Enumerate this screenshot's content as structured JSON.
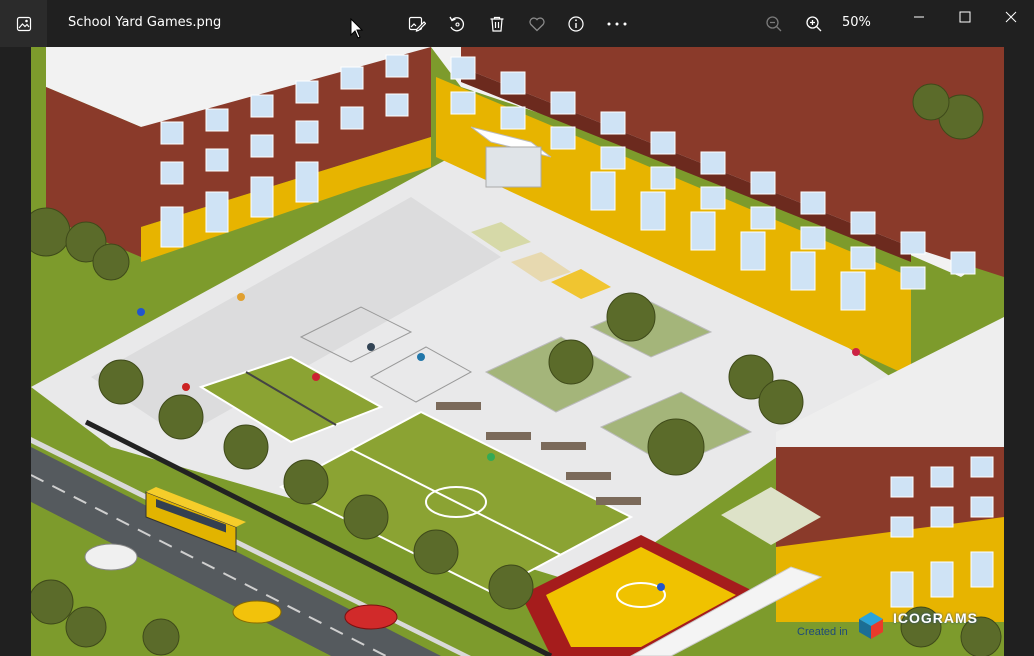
{
  "window": {
    "filename": "School Yard Games.png",
    "zoom_label": "50%"
  },
  "toolbar": {
    "icons": [
      "edit-image-icon",
      "rotate-icon",
      "delete-icon",
      "favorite-icon",
      "info-icon",
      "more-icon",
      "zoom-out-icon",
      "zoom-in-icon"
    ]
  },
  "window_controls": [
    "minimize-icon",
    "maximize-icon",
    "close-icon"
  ],
  "image": {
    "watermark_prefix": "Created in",
    "watermark_brand": "ICOGRAMS"
  },
  "colors": {
    "titlebar": "#202020",
    "brick": "#8a3a2a",
    "yellow": "#e7b400",
    "grass": "#8ba333",
    "plaza": "#e9e9ea",
    "court_red": "#a51c1c",
    "court_yellow": "#f0c200"
  }
}
